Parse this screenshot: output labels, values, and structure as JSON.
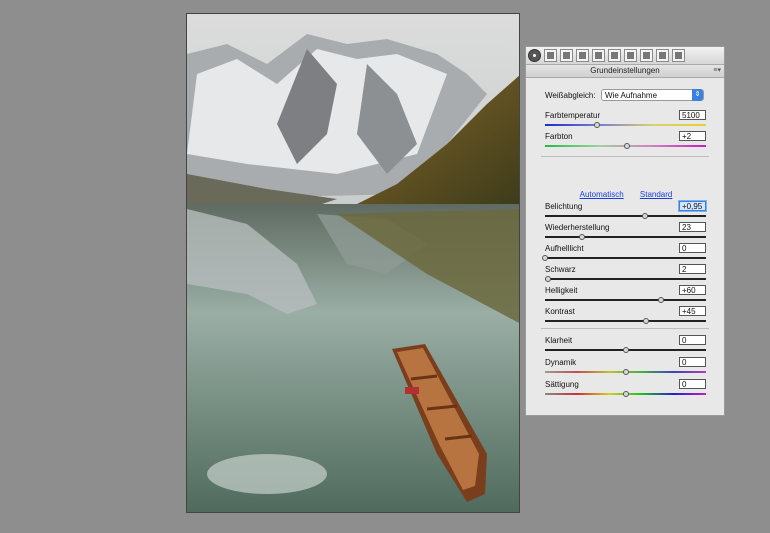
{
  "panel": {
    "title": "Grundeinstellungen",
    "tab_icons": [
      "basic-tab-icon",
      "tone-curve-tab-icon",
      "detail-tab-icon",
      "hsl-tab-icon",
      "split-toning-tab-icon",
      "lens-tab-icon",
      "fx-tab-icon",
      "camera-calibration-tab-icon",
      "presets-tab-icon",
      "snapshots-tab-icon"
    ],
    "white_balance": {
      "label": "Weißabgleich:",
      "value": "Wie Aufnahme"
    },
    "links": {
      "auto": "Automatisch",
      "default": "Standard"
    },
    "sliders_wb": [
      {
        "label": "Farbtemperatur",
        "value": "5100",
        "fraction": 0.32,
        "gradient": "linear-gradient(90deg,#1a2fd0,#7a7ad0,#d8d070,#e8d030)"
      },
      {
        "label": "Farbton",
        "value": "+2",
        "fraction": 0.51,
        "gradient": "linear-gradient(90deg,#1fbf3f,#a0d0a0,#d080c0,#c020c0)"
      }
    ],
    "sliders_tone": [
      {
        "label": "Belichtung",
        "value": "+0,95",
        "fraction": 0.62,
        "focus": true
      },
      {
        "label": "Wiederherstellung",
        "value": "23",
        "fraction": 0.23
      },
      {
        "label": "Aufhelllicht",
        "value": "0",
        "fraction": 0.0
      },
      {
        "label": "Schwarz",
        "value": "2",
        "fraction": 0.02
      },
      {
        "label": "Helligkeit",
        "value": "+60",
        "fraction": 0.72
      },
      {
        "label": "Kontrast",
        "value": "+45",
        "fraction": 0.63
      }
    ],
    "sliders_presence": [
      {
        "label": "Klarheit",
        "value": "0",
        "fraction": 0.5,
        "gradient": "#222"
      },
      {
        "label": "Dynamik",
        "value": "0",
        "fraction": 0.5,
        "gradient": "linear-gradient(90deg,#999,#c05050,#c0c030,#40b040,#4040c0,#b040b0)"
      },
      {
        "label": "Sättigung",
        "value": "0",
        "fraction": 0.5,
        "gradient": "linear-gradient(90deg,#888,#d03030,#d0d020,#20c020,#2020d0,#c020c0)"
      }
    ]
  }
}
